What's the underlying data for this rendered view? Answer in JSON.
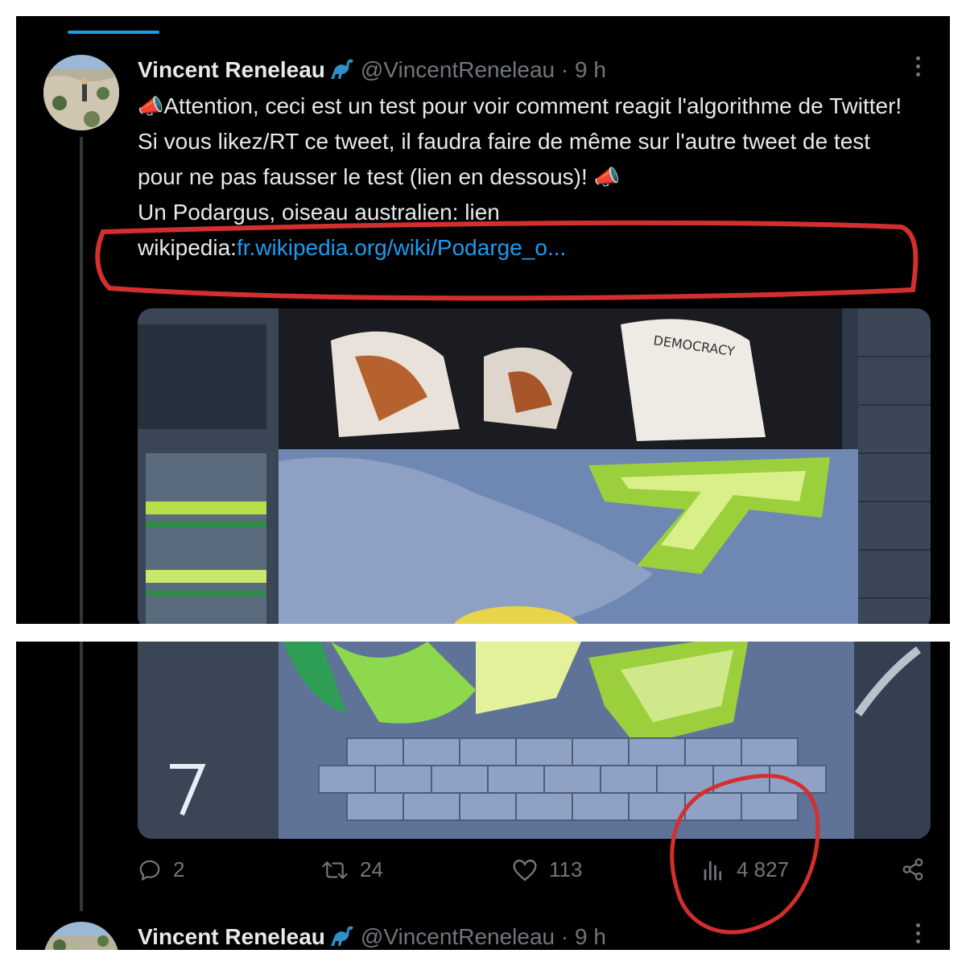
{
  "tweet": {
    "display_name": "Vincent Reneleau",
    "handle": "@VincentReneleau",
    "separator": "·",
    "time": "9 h",
    "text_line1": "Attention, ceci est un test pour voir comment reagit l'algorithme de Twitter! Si vous likez/RT ce tweet, il faudra faire de même sur l'autre tweet de test pour ne pas fausser le test (lien en dessous)!",
    "text_line2_prefix": "Un Podargus, oiseau australien: lien wikipedia:",
    "link_text": "fr.wikipedia.org/wiki/Podarge_o...",
    "media_text": "DEMOCRACY"
  },
  "actions": {
    "replies": "2",
    "retweets": "24",
    "likes": "113",
    "views": "4 827"
  },
  "next_tweet": {
    "display_name": "Vincent Reneleau",
    "handle": "@VincentReneleau",
    "separator": "·",
    "time": "9 h"
  },
  "colors": {
    "background": "#000000",
    "text": "#e7e9ea",
    "muted": "#71767b",
    "accent": "#1d9bf0",
    "annotation": "#d32f2f"
  }
}
